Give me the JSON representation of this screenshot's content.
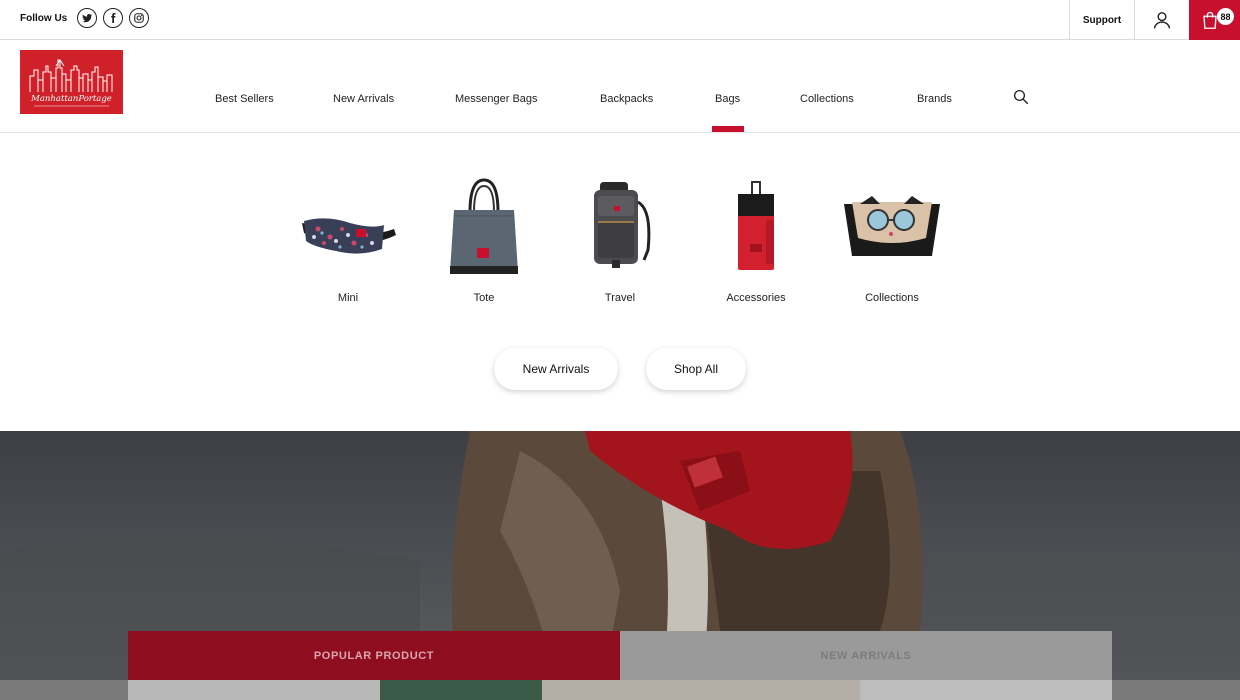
{
  "topbar": {
    "follow_label": "Follow Us",
    "social_icons": [
      "twitter-icon",
      "facebook-icon",
      "instagram-icon"
    ],
    "support_label": "Support",
    "account_icon": "user-icon",
    "cart_icon": "shopping-bag-icon",
    "cart_count": "88"
  },
  "brand": {
    "logo_text": "ManhattanPortage",
    "color": "#c8102e"
  },
  "nav": {
    "items": [
      {
        "label": "Best Sellers"
      },
      {
        "label": "New Arrivals"
      },
      {
        "label": "Messenger Bags"
      },
      {
        "label": "Backpacks"
      },
      {
        "label": "Bags"
      },
      {
        "label": "Collections"
      },
      {
        "label": "Brands"
      }
    ],
    "active": "Bags",
    "search_icon": "search-icon"
  },
  "dropdown": {
    "categories": [
      {
        "label": "Mini"
      },
      {
        "label": "Tote"
      },
      {
        "label": "Travel"
      },
      {
        "label": "Accessories"
      },
      {
        "label": "Collections"
      }
    ],
    "buttons": [
      {
        "label": "New Arrivals"
      },
      {
        "label": "Shop All"
      }
    ]
  },
  "tabs": [
    {
      "label": "POPULAR PRODUCT",
      "active": true
    },
    {
      "label": "NEW ARRIVALS",
      "active": false
    }
  ],
  "colors": {
    "accent": "#c8102e",
    "tab_active": "#8e0e1f",
    "tab_inactive": "#9a9a9a"
  }
}
